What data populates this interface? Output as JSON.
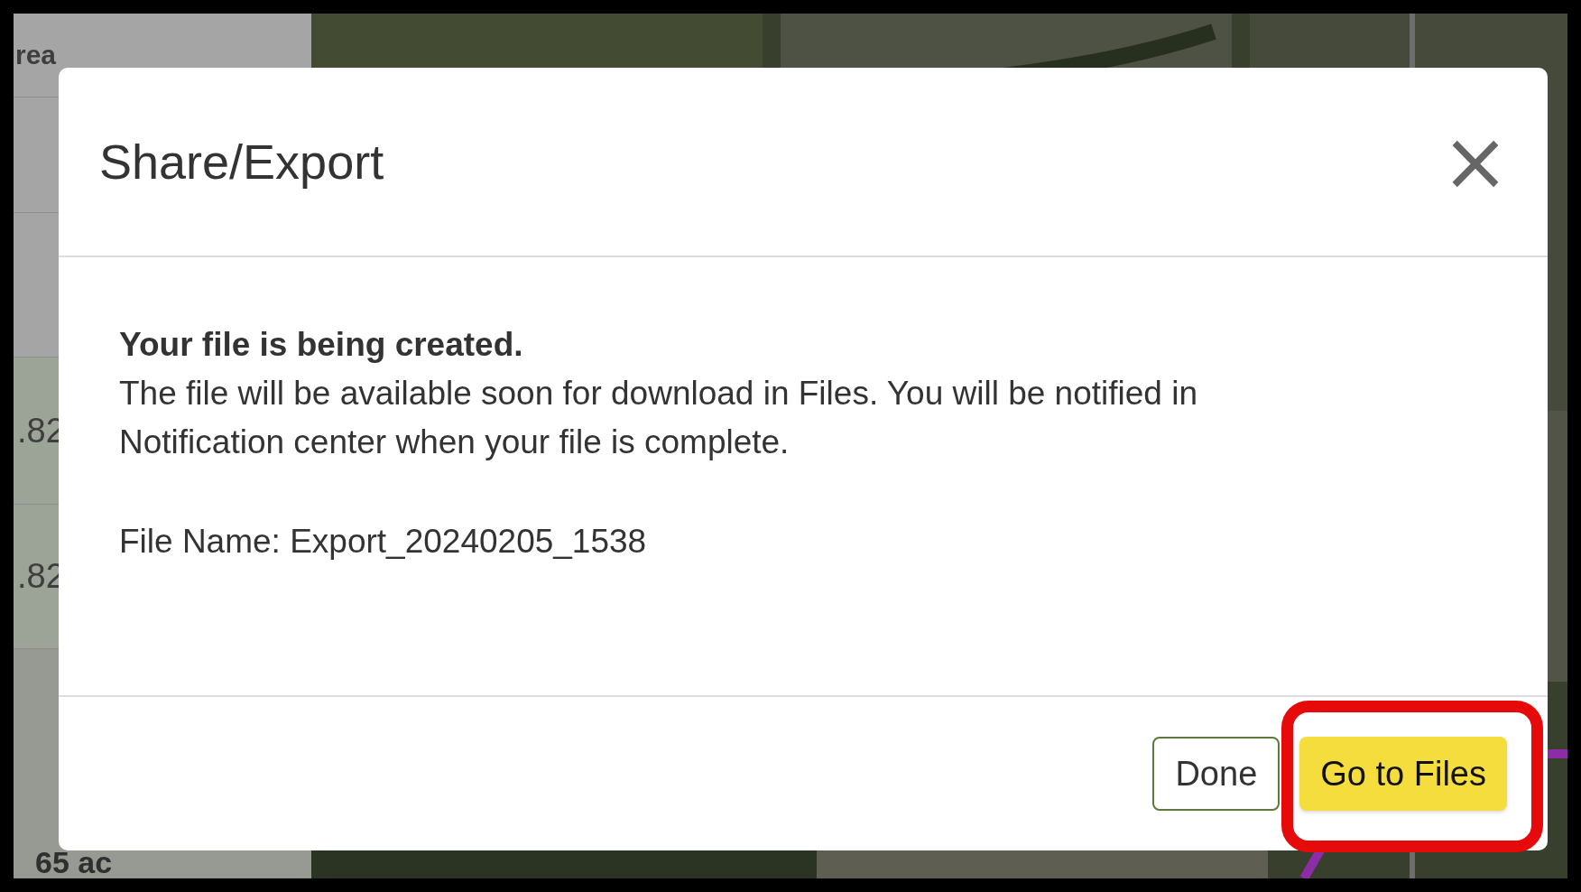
{
  "side_panel": {
    "rows": [
      {
        "kind": "header",
        "text": "rea"
      },
      {
        "kind": "blank"
      },
      {
        "kind": "blank"
      },
      {
        "kind": "value",
        "text": ".82"
      },
      {
        "kind": "value",
        "text": ".82"
      },
      {
        "kind": "total",
        "text": "65 ac"
      }
    ]
  },
  "dialog": {
    "title": "Share/Export",
    "close": "×",
    "heading": "Your file is being created.",
    "message": "The file will be available soon for download in Files. You will be notified in Notification center when your file is complete.",
    "file_name": "File Name: Export_20240205_1538",
    "buttons": [
      {
        "label": "Done",
        "kind": "secondary",
        "highlighted": false
      },
      {
        "label": "Go to Files",
        "kind": "primary",
        "highlighted": true
      }
    ]
  }
}
